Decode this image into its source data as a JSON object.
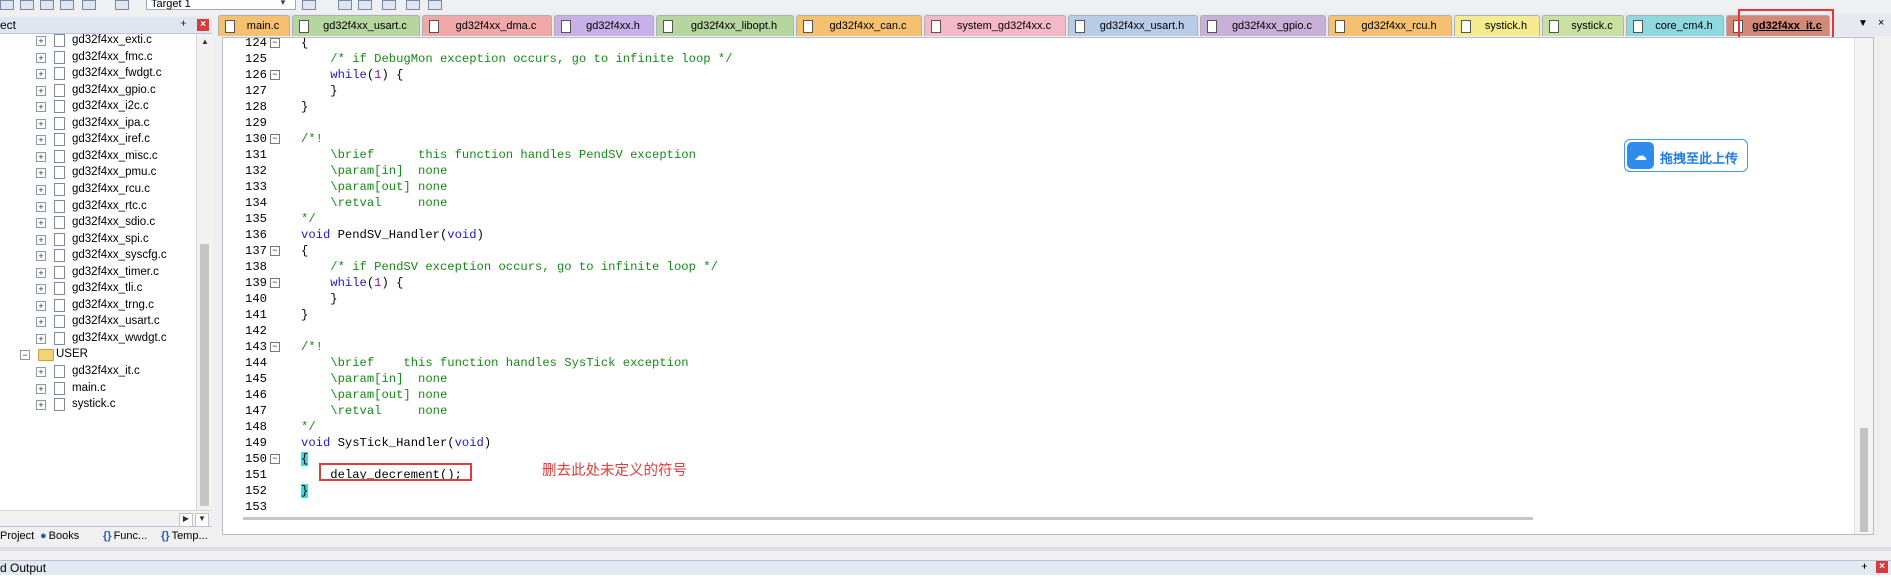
{
  "toolbar": {
    "target_value": "Target 1"
  },
  "project_panel": {
    "title": "ect",
    "items": [
      {
        "label": "gd32f4xx_exti.c",
        "kind": "file"
      },
      {
        "label": "gd32f4xx_fmc.c",
        "kind": "file"
      },
      {
        "label": "gd32f4xx_fwdgt.c",
        "kind": "file"
      },
      {
        "label": "gd32f4xx_gpio.c",
        "kind": "file"
      },
      {
        "label": "gd32f4xx_i2c.c",
        "kind": "file"
      },
      {
        "label": "gd32f4xx_ipa.c",
        "kind": "file"
      },
      {
        "label": "gd32f4xx_iref.c",
        "kind": "file"
      },
      {
        "label": "gd32f4xx_misc.c",
        "kind": "file"
      },
      {
        "label": "gd32f4xx_pmu.c",
        "kind": "file"
      },
      {
        "label": "gd32f4xx_rcu.c",
        "kind": "file"
      },
      {
        "label": "gd32f4xx_rtc.c",
        "kind": "file"
      },
      {
        "label": "gd32f4xx_sdio.c",
        "kind": "file"
      },
      {
        "label": "gd32f4xx_spi.c",
        "kind": "file"
      },
      {
        "label": "gd32f4xx_syscfg.c",
        "kind": "file"
      },
      {
        "label": "gd32f4xx_timer.c",
        "kind": "file"
      },
      {
        "label": "gd32f4xx_tli.c",
        "kind": "file"
      },
      {
        "label": "gd32f4xx_trng.c",
        "kind": "file"
      },
      {
        "label": "gd32f4xx_usart.c",
        "kind": "file"
      },
      {
        "label": "gd32f4xx_wwdgt.c",
        "kind": "file"
      },
      {
        "label": "USER",
        "kind": "folder"
      },
      {
        "label": "gd32f4xx_it.c",
        "kind": "file"
      },
      {
        "label": "main.c",
        "kind": "file"
      },
      {
        "label": "systick.c",
        "kind": "file"
      }
    ],
    "tabs": [
      {
        "label": "Project",
        "icon": "project-icon"
      },
      {
        "label": "Books",
        "icon": "books-icon"
      },
      {
        "label": "Func...",
        "icon": "functions-icon"
      },
      {
        "label": "Temp...",
        "icon": "templates-icon"
      }
    ]
  },
  "editor_tabs": [
    {
      "label": "main.c",
      "color": "#f5c070"
    },
    {
      "label": "gd32f4xx_usart.c",
      "color": "#b6d6a0"
    },
    {
      "label": "gd32f4xx_dma.c",
      "color": "#f0a8a8"
    },
    {
      "label": "gd32f4xx.h",
      "color": "#c8b0e8"
    },
    {
      "label": "gd32f4xx_libopt.h",
      "color": "#b6d6a0"
    },
    {
      "label": "gd32f4xx_can.c",
      "color": "#f5c070"
    },
    {
      "label": "system_gd32f4xx.c",
      "color": "#f4b8c8"
    },
    {
      "label": "gd32f4xx_usart.h",
      "color": "#b8cce8"
    },
    {
      "label": "gd32f4xx_gpio.c",
      "color": "#c8b0d8"
    },
    {
      "label": "gd32f4xx_rcu.h",
      "color": "#f5c070"
    },
    {
      "label": "systick.h",
      "color": "#f5ec90"
    },
    {
      "label": "systick.c",
      "color": "#c8e0a0"
    },
    {
      "label": "core_cm4.h",
      "color": "#90d8e0"
    },
    {
      "label": "gd32f4xx_it.c",
      "color": "#d48878",
      "active": true
    }
  ],
  "code_lines": [
    {
      "n": "124",
      "fold": "minus",
      "segs": [
        {
          "t": "{",
          "c": "plain"
        }
      ]
    },
    {
      "n": "125",
      "segs": [
        {
          "t": "    /* if DebugMon exception occurs, go to infinite loop */",
          "c": "comment"
        }
      ]
    },
    {
      "n": "126",
      "fold": "minus",
      "segs": [
        {
          "t": "    ",
          "c": "plain"
        },
        {
          "t": "while",
          "c": "kw"
        },
        {
          "t": "(",
          "c": "plain"
        },
        {
          "t": "1",
          "c": "num"
        },
        {
          "t": ") {",
          "c": "plain"
        }
      ]
    },
    {
      "n": "127",
      "segs": [
        {
          "t": "    }",
          "c": "plain"
        }
      ]
    },
    {
      "n": "128",
      "segs": [
        {
          "t": "}",
          "c": "plain"
        }
      ]
    },
    {
      "n": "129",
      "segs": []
    },
    {
      "n": "130",
      "fold": "minus",
      "segs": [
        {
          "t": "/*!",
          "c": "comment"
        }
      ]
    },
    {
      "n": "131",
      "segs": [
        {
          "t": "    \\brief      this function handles PendSV exception",
          "c": "comment"
        }
      ]
    },
    {
      "n": "132",
      "segs": [
        {
          "t": "    \\param[in]  none",
          "c": "comment"
        }
      ]
    },
    {
      "n": "133",
      "segs": [
        {
          "t": "    \\param[out] none",
          "c": "comment"
        }
      ]
    },
    {
      "n": "134",
      "segs": [
        {
          "t": "    \\retval     none",
          "c": "comment"
        }
      ]
    },
    {
      "n": "135",
      "segs": [
        {
          "t": "*/",
          "c": "comment"
        }
      ]
    },
    {
      "n": "136",
      "segs": [
        {
          "t": "void",
          "c": "kw"
        },
        {
          "t": " PendSV_Handler(",
          "c": "plain"
        },
        {
          "t": "void",
          "c": "kw"
        },
        {
          "t": ")",
          "c": "plain"
        }
      ]
    },
    {
      "n": "137",
      "fold": "minus",
      "segs": [
        {
          "t": "{",
          "c": "plain"
        }
      ]
    },
    {
      "n": "138",
      "segs": [
        {
          "t": "    /* if PendSV exception occurs, go to infinite loop */",
          "c": "comment"
        }
      ]
    },
    {
      "n": "139",
      "fold": "minus",
      "segs": [
        {
          "t": "    ",
          "c": "plain"
        },
        {
          "t": "while",
          "c": "kw"
        },
        {
          "t": "(",
          "c": "plain"
        },
        {
          "t": "1",
          "c": "num"
        },
        {
          "t": ") {",
          "c": "plain"
        }
      ]
    },
    {
      "n": "140",
      "segs": [
        {
          "t": "    }",
          "c": "plain"
        }
      ]
    },
    {
      "n": "141",
      "segs": [
        {
          "t": "}",
          "c": "plain"
        }
      ]
    },
    {
      "n": "142",
      "segs": []
    },
    {
      "n": "143",
      "fold": "minus",
      "segs": [
        {
          "t": "/*!",
          "c": "comment"
        }
      ]
    },
    {
      "n": "144",
      "segs": [
        {
          "t": "    \\brief    this function handles SysTick exception",
          "c": "comment"
        }
      ]
    },
    {
      "n": "145",
      "segs": [
        {
          "t": "    \\param[in]  none",
          "c": "comment"
        }
      ]
    },
    {
      "n": "146",
      "segs": [
        {
          "t": "    \\param[out] none",
          "c": "comment"
        }
      ]
    },
    {
      "n": "147",
      "segs": [
        {
          "t": "    \\retval     none",
          "c": "comment"
        }
      ]
    },
    {
      "n": "148",
      "segs": [
        {
          "t": "*/",
          "c": "comment"
        }
      ]
    },
    {
      "n": "149",
      "segs": [
        {
          "t": "void",
          "c": "kw"
        },
        {
          "t": " SysTick_Handler(",
          "c": "plain"
        },
        {
          "t": "void",
          "c": "kw"
        },
        {
          "t": ")",
          "c": "plain"
        }
      ]
    },
    {
      "n": "150",
      "fold": "minus",
      "segs": [
        {
          "t": "{",
          "c": "brace"
        }
      ]
    },
    {
      "n": "151",
      "segs": [
        {
          "t": "    delay_decrement();",
          "c": "plain"
        }
      ]
    },
    {
      "n": "152",
      "segs": [
        {
          "t": "}",
          "c": "brace"
        }
      ]
    },
    {
      "n": "153",
      "segs": []
    }
  ],
  "annotation": {
    "note": "删去此处未定义的符号"
  },
  "upload_button": {
    "label": "拖拽至此上传"
  },
  "output_panel": {
    "title": "d Output"
  }
}
